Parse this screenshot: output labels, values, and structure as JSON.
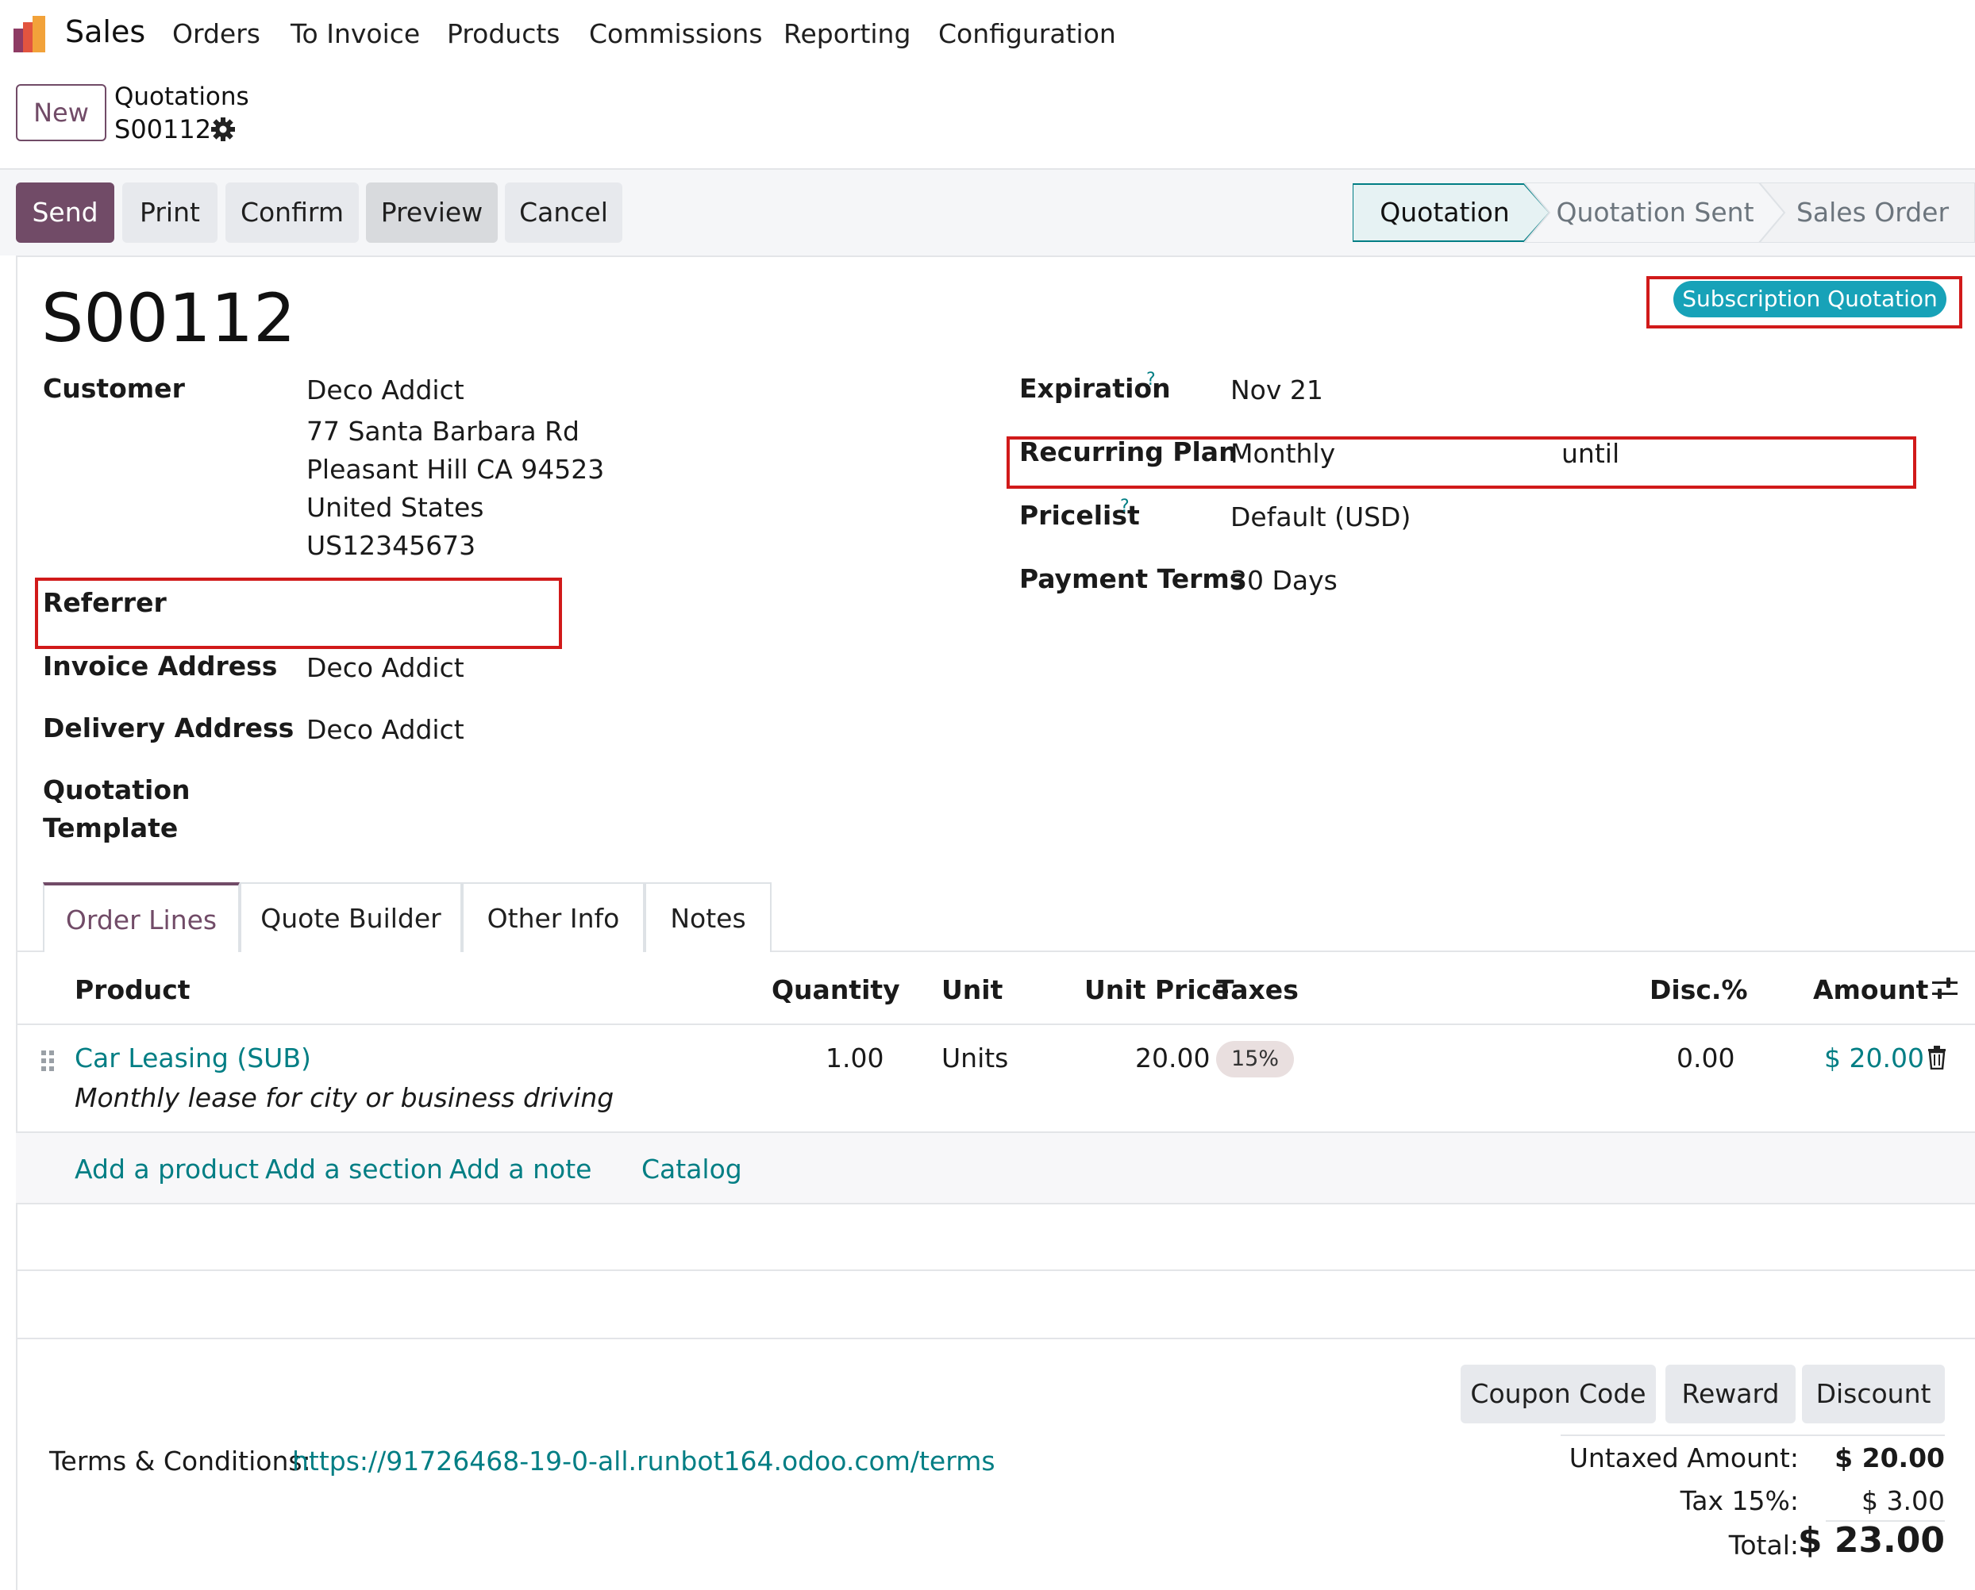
{
  "nav": {
    "app_name": "Sales",
    "menu": [
      "Orders",
      "To Invoice",
      "Products",
      "Commissions",
      "Reporting",
      "Configuration"
    ]
  },
  "breadcrumb": {
    "new_label": "New",
    "parent": "Quotations",
    "current": "S00112"
  },
  "actions": {
    "send": "Send",
    "print": "Print",
    "confirm": "Confirm",
    "preview": "Preview",
    "cancel": "Cancel"
  },
  "statusbar": {
    "stages": [
      "Quotation",
      "Quotation Sent",
      "Sales Order"
    ],
    "active": "Quotation"
  },
  "record": {
    "name": "S00112",
    "badge": "Subscription Quotation",
    "customer_label": "Customer",
    "customer_lines": [
      "Deco Addict",
      "77 Santa Barbara Rd",
      "Pleasant Hill CA 94523",
      "United States",
      "US12345673"
    ],
    "referrer_label": "Referrer",
    "invoice_label": "Invoice Address",
    "invoice_value": "Deco Addict",
    "delivery_label": "Delivery Address",
    "delivery_value": "Deco Addict",
    "template_label_1": "Quotation",
    "template_label_2": "Template",
    "expiration_label": "Expiration",
    "expiration_value": "Nov 21",
    "help_mark": "?",
    "recurring_label": "Recurring Plan",
    "recurring_value": "Monthly",
    "recurring_until": "until",
    "pricelist_label": "Pricelist",
    "pricelist_value": "Default (USD)",
    "payment_label": "Payment Terms",
    "payment_value": "30 Days"
  },
  "tabs": [
    "Order Lines",
    "Quote Builder",
    "Other Info",
    "Notes"
  ],
  "order_lines": {
    "columns": [
      "Product",
      "Quantity",
      "Unit",
      "Unit Price",
      "Taxes",
      "Disc.%",
      "Amount"
    ],
    "rows": [
      {
        "product": "Car Leasing (SUB)",
        "description": "Monthly lease for city or business driving",
        "quantity": "1.00",
        "unit": "Units",
        "unit_price": "20.00",
        "tax": "15%",
        "discount": "0.00",
        "amount": "$ 20.00"
      }
    ],
    "add_links": [
      "Add a product",
      "Add a section",
      "Add a note",
      "Catalog"
    ]
  },
  "footer": {
    "terms_label": "Terms & Conditions:",
    "terms_link": "https://91726468-19-0-all.runbot164.odoo.com/terms",
    "buttons": [
      "Coupon Code",
      "Reward",
      "Discount"
    ],
    "untaxed_label": "Untaxed Amount:",
    "untaxed_value": "$ 20.00",
    "tax_label": "Tax 15%:",
    "tax_value": "$ 3.00",
    "total_label": "Total:",
    "total_value": "$ 23.00"
  },
  "colors": {
    "brand": "#714b67",
    "link": "#017e84",
    "badge": "#17a2b8",
    "highlight_box": "#d11a1a"
  },
  "icons": [
    "app-logo",
    "gear-icon",
    "help-icon",
    "drag-handle-icon",
    "trash-icon",
    "optional-columns-icon"
  ]
}
